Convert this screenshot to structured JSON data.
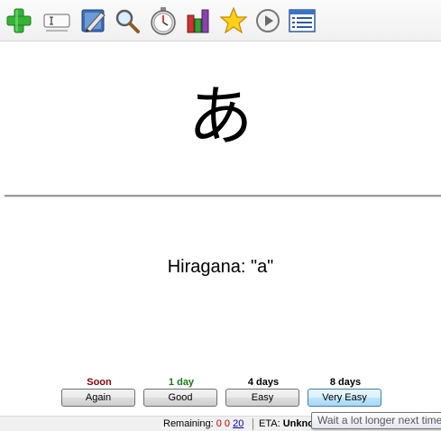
{
  "toolbar": {
    "buttons": [
      {
        "icon": "add-icon"
      },
      {
        "icon": "rename-field-icon"
      },
      {
        "icon": "edit-icon"
      },
      {
        "icon": "search-icon"
      },
      {
        "icon": "timer-icon"
      },
      {
        "icon": "statistics-icon"
      },
      {
        "icon": "star-icon"
      },
      {
        "icon": "play-icon"
      },
      {
        "icon": "list-icon"
      }
    ]
  },
  "card": {
    "question": "あ",
    "answer": "Hiragana: \"a\""
  },
  "ease": [
    {
      "time": "Soon",
      "label": "Again",
      "color": "#8b0000"
    },
    {
      "time": "1 day",
      "label": "Good",
      "color": "#1a7a1a"
    },
    {
      "time": "4 days",
      "label": "Easy",
      "color": "#000000"
    },
    {
      "time": "8 days",
      "label": "Very Easy",
      "color": "#000000"
    }
  ],
  "status": {
    "remaining_label": "Remaining:",
    "remaining_values": [
      "0",
      "0",
      "20"
    ],
    "eta_label": "ETA:",
    "eta_value": "Unkno"
  },
  "tooltip": "Wait a lot longer next time"
}
